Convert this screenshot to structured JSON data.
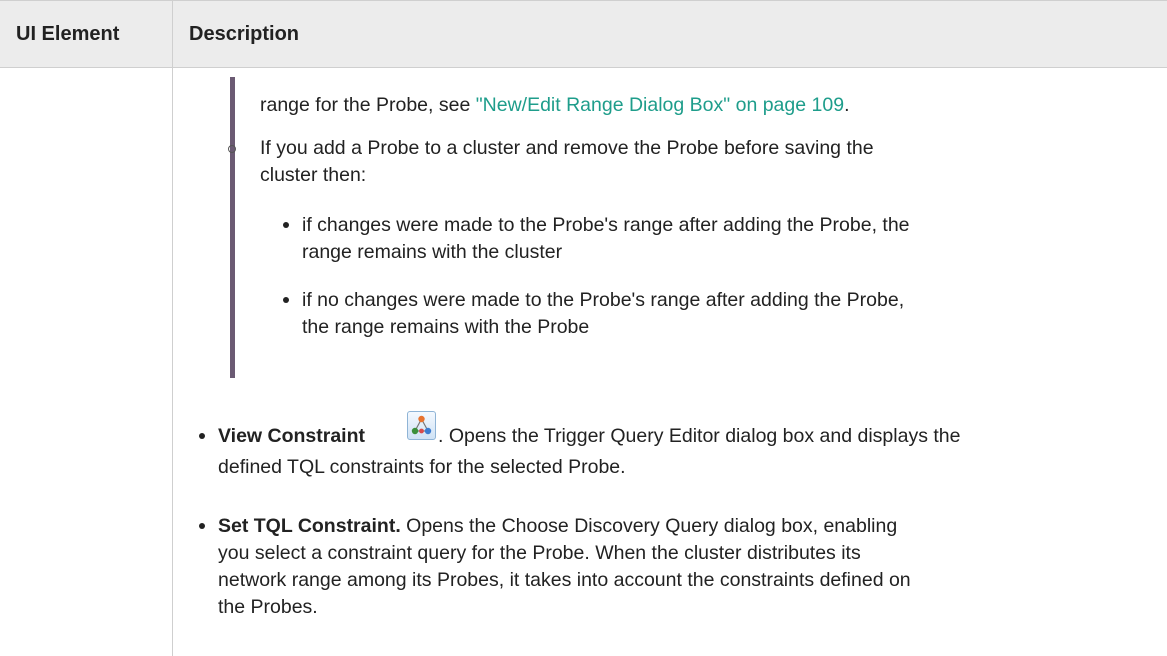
{
  "table": {
    "headers": {
      "ui_element": "UI Element",
      "description": "Description"
    }
  },
  "content": {
    "line1_prefix": "range for the Probe, see ",
    "line1_link": "\"New/Edit Range Dialog Box\" on page 109",
    "line1_suffix": ".",
    "sub_bullet_line1": "If you add a Probe to a cluster and remove the Probe before saving the",
    "sub_bullet_line2": "cluster then:",
    "inner_bullets": [
      {
        "line1": "if changes were made to the Probe's range after adding the Probe, the",
        "line2": "range remains with the cluster"
      },
      {
        "line1": "if no changes were made to the Probe's range after adding the Probe,",
        "line2": "the range remains with the Probe"
      }
    ],
    "view_constraint": {
      "title": "View Constraint",
      "icon": "tql-graph-icon",
      "text_line1": ". Opens the Trigger Query Editor dialog box and displays the",
      "text_line2": "defined TQL constraints for the selected Probe."
    },
    "set_tql_constraint": {
      "title": "Set TQL Constraint.",
      "text_line1": " Opens the Choose Discovery Query dialog box, enabling",
      "text_line2": "you select a constraint query for the Probe. When the cluster distributes its",
      "text_line3": "network range among its Probes, it takes into account the constraints defined on",
      "text_line4": "the Probes."
    }
  },
  "colors": {
    "link": "#1e9d8b",
    "header_bg": "#ececec",
    "sidebar_bar": "#6b5a73"
  }
}
